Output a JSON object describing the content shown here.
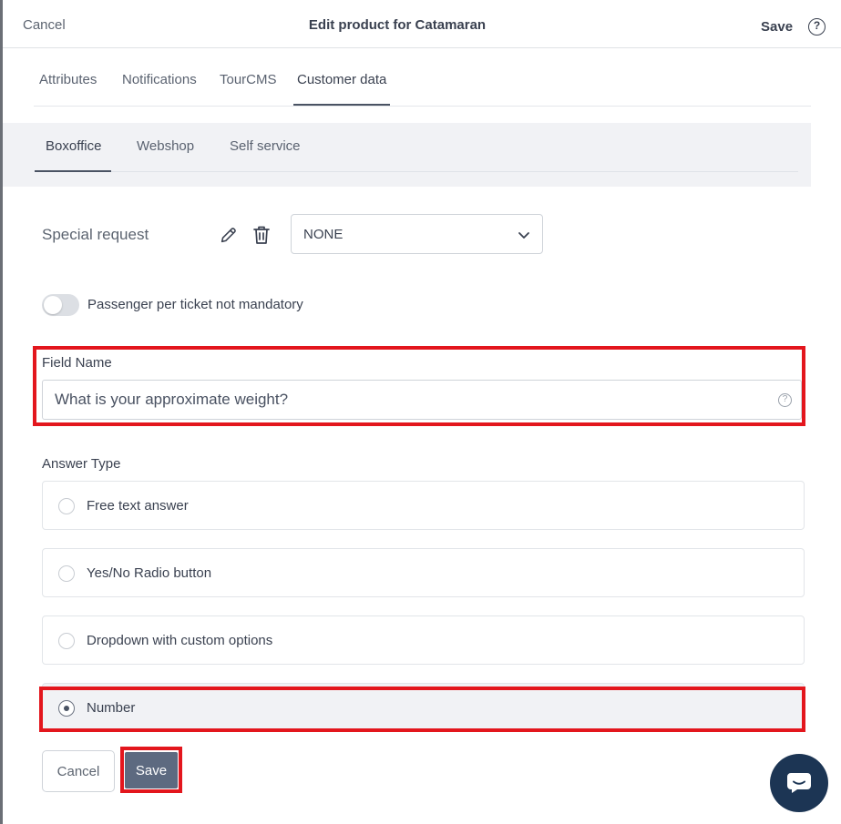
{
  "header": {
    "cancel_label": "Cancel",
    "title": "Edit product for Catamaran",
    "save_label": "Save",
    "help_glyph": "?"
  },
  "tabs": [
    {
      "label": "Attributes",
      "active": false
    },
    {
      "label": "Notifications",
      "active": false
    },
    {
      "label": "TourCMS",
      "active": false
    },
    {
      "label": "Customer data",
      "active": true
    }
  ],
  "subtabs": [
    {
      "label": "Boxoffice",
      "active": true
    },
    {
      "label": "Webshop",
      "active": false
    },
    {
      "label": "Self service",
      "active": false
    }
  ],
  "special_request": {
    "label": "Special request",
    "edit_icon": "pencil-icon",
    "delete_icon": "trash-icon",
    "select_value": "NONE"
  },
  "toggle": {
    "label": "Passenger per ticket not mandatory",
    "on": false
  },
  "field_name": {
    "label": "Field Name",
    "value": "What is your approximate weight?",
    "help_glyph": "?"
  },
  "answer_type": {
    "label": "Answer Type",
    "options": [
      {
        "label": "Free text answer",
        "selected": false
      },
      {
        "label": "Yes/No Radio button",
        "selected": false
      },
      {
        "label": "Dropdown with custom options",
        "selected": false
      },
      {
        "label": "Number",
        "selected": true
      }
    ]
  },
  "footer": {
    "cancel_label": "Cancel",
    "save_label": "Save"
  },
  "colors": {
    "highlight": "#e3161d",
    "primary_button": "#5d6a80",
    "chat_bubble": "#1c3554"
  }
}
